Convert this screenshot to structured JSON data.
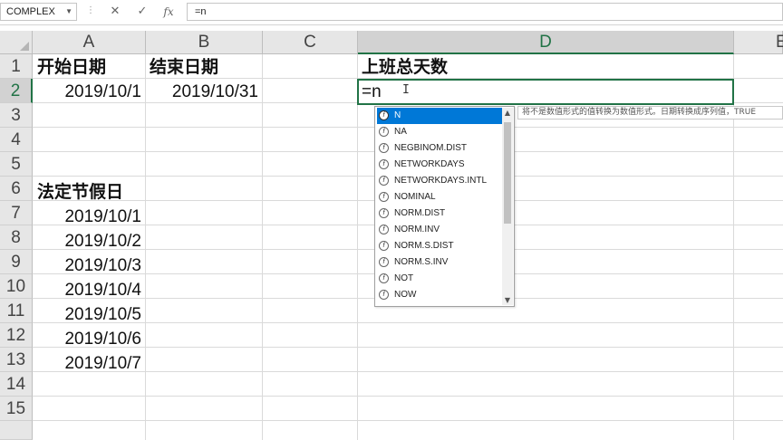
{
  "formula_bar": {
    "name_box": "COMPLEX",
    "cancel_icon": "✕",
    "enter_icon": "✓",
    "fx_label": "fx",
    "formula": "=n"
  },
  "columns": [
    "A",
    "B",
    "C",
    "D",
    "E"
  ],
  "rows": [
    "1",
    "2",
    "3",
    "4",
    "5",
    "6",
    "7",
    "8",
    "9",
    "10",
    "11",
    "12",
    "13",
    "14",
    "15"
  ],
  "cells": {
    "A1": "开始日期",
    "B1": "结束日期",
    "D1": "上班总天数",
    "A2": "2019/10/1",
    "B2": "2019/10/31",
    "D2": "=n",
    "A6": "法定节假日",
    "A7": "2019/10/1",
    "A8": "2019/10/2",
    "A9": "2019/10/3",
    "A10": "2019/10/4",
    "A11": "2019/10/5",
    "A12": "2019/10/6",
    "A13": "2019/10/7"
  },
  "autocomplete": {
    "items": [
      "N",
      "NA",
      "NEGBINOM.DIST",
      "NETWORKDAYS",
      "NETWORKDAYS.INTL",
      "NOMINAL",
      "NORM.DIST",
      "NORM.INV",
      "NORM.S.DIST",
      "NORM.S.INV",
      "NOT",
      "NOW"
    ],
    "selected_index": 0,
    "tooltip": "将不是数值形式的值转换为数值形式。日期转换成序列值，TRUE"
  },
  "colors": {
    "accent": "#217346",
    "selection": "#0078d7"
  }
}
